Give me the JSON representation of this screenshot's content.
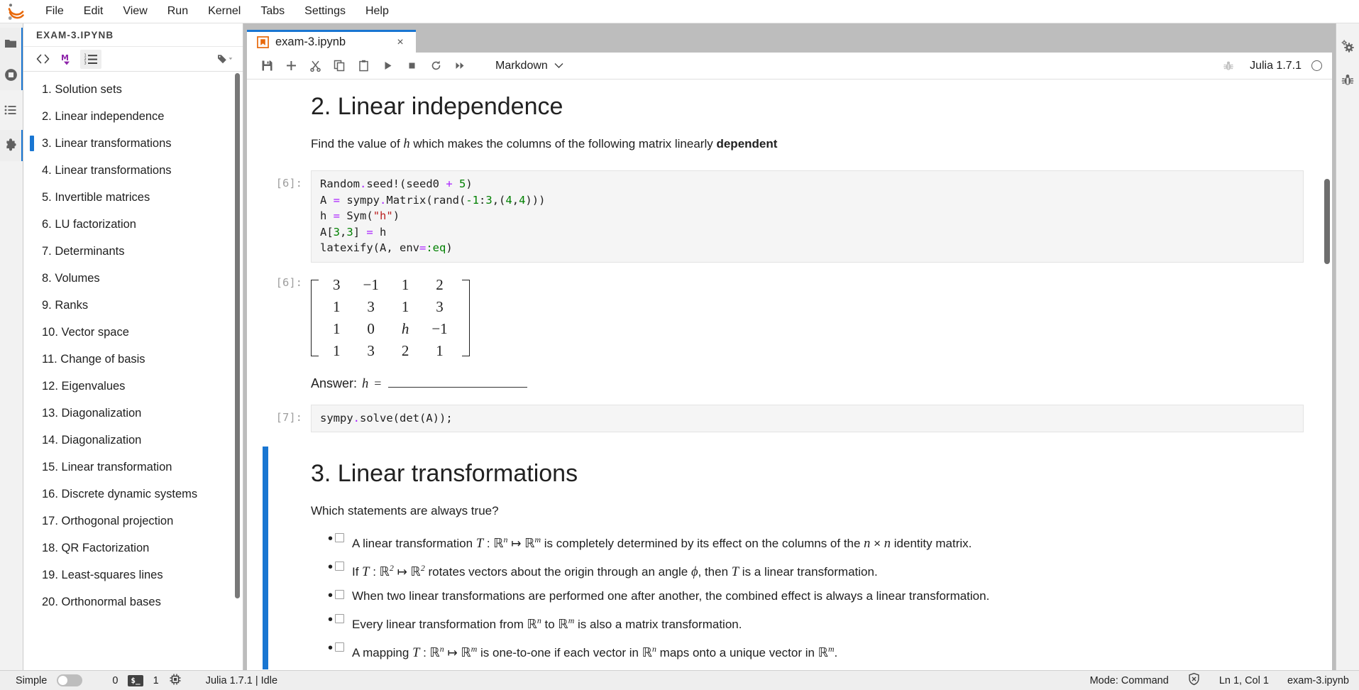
{
  "menubar": {
    "logo_name": "jupyter-logo",
    "items": [
      "File",
      "Edit",
      "View",
      "Run",
      "Kernel",
      "Tabs",
      "Settings",
      "Help"
    ]
  },
  "activitybar": {
    "items": [
      {
        "name": "file-browser-icon",
        "label": "folder-icon"
      },
      {
        "name": "running-terminals-icon",
        "label": "stop-circle-icon"
      },
      {
        "name": "table-of-contents-icon",
        "label": "list-icon"
      },
      {
        "name": "extension-manager-icon",
        "label": "puzzle-icon"
      }
    ]
  },
  "leftpanel": {
    "title": "EXAM-3.IPYNB",
    "toolbar": [
      {
        "name": "toc-code-toggle",
        "glyph": "<>"
      },
      {
        "name": "toc-markdown-toggle",
        "glyph": "M"
      },
      {
        "name": "toc-numbering-toggle",
        "glyph": "list-numbered"
      },
      {
        "name": "toc-tag-dropdown",
        "glyph": "tag"
      }
    ],
    "active_index": 2,
    "items": [
      "1. Solution sets",
      "2. Linear independence",
      "3. Linear transformations",
      "4. Linear transformations",
      "5. Invertible matrices",
      "6. LU factorization",
      "7. Determinants",
      "8. Volumes",
      "9. Ranks",
      "10. Vector space",
      "11. Change of basis",
      "12. Eigenvalues",
      "13. Diagonalization",
      "14. Diagonalization",
      "15. Linear transformation",
      "16. Discrete dynamic systems",
      "17. Orthogonal projection",
      "18. QR Factorization",
      "19. Least-squares lines",
      "20. Orthonormal bases"
    ]
  },
  "tabbar": {
    "tabs": [
      {
        "label": "exam-3.ipynb",
        "icon": "notebook-icon",
        "close": "×",
        "active": true
      }
    ]
  },
  "notebook_toolbar": {
    "buttons": [
      {
        "name": "save-button",
        "icon": "save-icon"
      },
      {
        "name": "insert-cell-button",
        "icon": "plus-icon"
      },
      {
        "name": "cut-cell-button",
        "icon": "scissors-icon"
      },
      {
        "name": "copy-cell-button",
        "icon": "copy-icon"
      },
      {
        "name": "paste-cell-button",
        "icon": "paste-icon"
      },
      {
        "name": "run-cell-button",
        "icon": "play-icon"
      },
      {
        "name": "interrupt-kernel-button",
        "icon": "stop-icon"
      },
      {
        "name": "restart-kernel-button",
        "icon": "restart-icon"
      },
      {
        "name": "restart-run-all-button",
        "icon": "fast-forward-icon"
      }
    ],
    "celltype_value": "Markdown",
    "celltype_chevron": "⌄",
    "debugger_icon": "bug-icon",
    "kernel_name": "Julia 1.7.1",
    "kernel_status": "idle"
  },
  "notebook": {
    "cells": [
      {
        "type": "markdown",
        "prompt": "",
        "heading": "2. Linear independence",
        "paragraph_pre": "Find the value of ",
        "paragraph_var": "h",
        "paragraph_mid": " which makes the columns of the following matrix linearly ",
        "paragraph_bold": "dependent"
      },
      {
        "type": "code",
        "prompt": "[6]:",
        "lines": [
          "Random.seed!(seed0 + 5)",
          "A = sympy.Matrix(rand(-1:3,(4,4)))",
          "h = Sym(\"h\")",
          "A[3,3] = h",
          "latexify(A, env=:eq)"
        ]
      },
      {
        "type": "output",
        "prompt": "[6]:",
        "matrix": [
          [
            "3",
            "−1",
            "1",
            "2"
          ],
          [
            "1",
            "3",
            "1",
            "3"
          ],
          [
            "1",
            "0",
            "h",
            "−1"
          ],
          [
            "1",
            "3",
            "2",
            "1"
          ]
        ],
        "italic_cells": [
          [
            2,
            2
          ]
        ]
      },
      {
        "type": "markdown",
        "prompt": "",
        "answer_label": "Answer:",
        "answer_var": "h",
        "answer_eq": "="
      },
      {
        "type": "code",
        "prompt": "[7]:",
        "lines": [
          "sympy.solve(det(A));"
        ]
      },
      {
        "type": "markdown",
        "prompt": "",
        "selected": true,
        "heading": "3. Linear transformations",
        "question": "Which statements are always true?",
        "statements": [
          {
            "checked": false,
            "parts": [
              {
                "t": "text",
                "v": "A linear transformation "
              },
              {
                "t": "mathit",
                "v": "T"
              },
              {
                "t": "text",
                "v": " : "
              },
              {
                "t": "bb",
                "v": "ℝ",
                "sup": "n"
              },
              {
                "t": "text",
                "v": " ↦ "
              },
              {
                "t": "bb",
                "v": "ℝ",
                "sup": "m"
              },
              {
                "t": "text",
                "v": " is completely determined by its effect on the columns of the "
              },
              {
                "t": "mathit",
                "v": "n"
              },
              {
                "t": "text",
                "v": " × "
              },
              {
                "t": "mathit",
                "v": "n"
              },
              {
                "t": "text",
                "v": " identity matrix."
              }
            ]
          },
          {
            "checked": false,
            "parts": [
              {
                "t": "text",
                "v": "If "
              },
              {
                "t": "mathit",
                "v": "T"
              },
              {
                "t": "text",
                "v": " : "
              },
              {
                "t": "bb",
                "v": "ℝ",
                "sup": "2"
              },
              {
                "t": "text",
                "v": " ↦ "
              },
              {
                "t": "bb",
                "v": "ℝ",
                "sup": "2"
              },
              {
                "t": "text",
                "v": " rotates vectors about the origin through an angle "
              },
              {
                "t": "mathit",
                "v": "ϕ"
              },
              {
                "t": "text",
                "v": ", then "
              },
              {
                "t": "mathit",
                "v": "T"
              },
              {
                "t": "text",
                "v": " is a linear transformation."
              }
            ]
          },
          {
            "checked": false,
            "parts": [
              {
                "t": "text",
                "v": "When two linear transformations are performed one after another, the combined effect is always a linear transformation."
              }
            ]
          },
          {
            "checked": false,
            "parts": [
              {
                "t": "text",
                "v": "Every linear transformation from "
              },
              {
                "t": "bb",
                "v": "ℝ",
                "sup": "n"
              },
              {
                "t": "text",
                "v": " to "
              },
              {
                "t": "bb",
                "v": "ℝ",
                "sup": "m"
              },
              {
                "t": "text",
                "v": " is also a matrix transformation."
              }
            ]
          },
          {
            "checked": false,
            "parts": [
              {
                "t": "text",
                "v": "A mapping "
              },
              {
                "t": "mathit",
                "v": "T"
              },
              {
                "t": "text",
                "v": " : "
              },
              {
                "t": "bb",
                "v": "ℝ",
                "sup": "n"
              },
              {
                "t": "text",
                "v": " ↦ "
              },
              {
                "t": "bb",
                "v": "ℝ",
                "sup": "m"
              },
              {
                "t": "text",
                "v": " is one-to-one if each vector in "
              },
              {
                "t": "bb",
                "v": "ℝ",
                "sup": "n"
              },
              {
                "t": "text",
                "v": " maps onto a unique vector in "
              },
              {
                "t": "bb",
                "v": "ℝ",
                "sup": "m"
              },
              {
                "t": "text",
                "v": "."
              }
            ]
          }
        ]
      }
    ]
  },
  "rightbar": {
    "items": [
      {
        "name": "property-inspector-icon"
      },
      {
        "name": "debugger-panel-icon"
      }
    ]
  },
  "statusbar": {
    "mode_label": "Simple",
    "toggle_on": false,
    "kernel_count": "0",
    "terminal_badge": "$_",
    "terminal_count": "1",
    "kernel_status": "Julia 1.7.1 | Idle",
    "edit_mode": "Mode: Command",
    "cursor": "Ln 1, Col 1",
    "filename": "exam-3.ipynb"
  },
  "colors": {
    "accent": "#1976d2",
    "chrome": "#bdbdbd",
    "panel": "#f2f2f2",
    "code_bg": "#f5f5f5"
  }
}
